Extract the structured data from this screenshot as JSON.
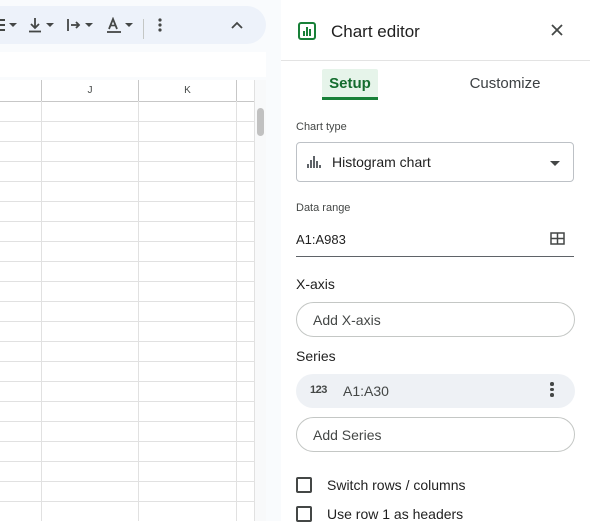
{
  "spreadsheet": {
    "columns": [
      "J",
      "K"
    ],
    "toolbar_icons": [
      "align-icon",
      "vertical-align-icon",
      "text-wrap-icon",
      "text-rotation-icon",
      "more-icon",
      "collapse-icon"
    ]
  },
  "editor": {
    "title": "Chart editor",
    "accent_color": "#188038",
    "tabs": [
      {
        "label": "Setup",
        "active": true
      },
      {
        "label": "Customize",
        "active": false
      }
    ],
    "chart_type": {
      "label": "Chart type",
      "value": "Histogram chart",
      "icon": "histogram-icon"
    },
    "data_range": {
      "label": "Data range",
      "value": "A1:A983"
    },
    "x_axis": {
      "label": "X-axis",
      "placeholder": "Add X-axis"
    },
    "series": {
      "label": "Series",
      "items": [
        {
          "type_icon": "123",
          "range": "A1:A30"
        }
      ],
      "add_label": "Add Series"
    },
    "options": [
      {
        "label": "Switch rows / columns",
        "checked": false
      },
      {
        "label": "Use row 1 as headers",
        "checked": false
      }
    ]
  }
}
